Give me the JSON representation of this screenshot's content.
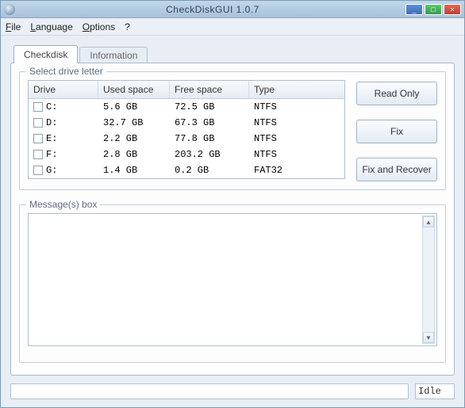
{
  "title": "CheckDiskGUI 1.0.7",
  "menu": {
    "file": "File",
    "language": "Language",
    "options": "Options",
    "help": "?"
  },
  "tabs": {
    "checkdisk": "Checkdisk",
    "information": "Information"
  },
  "drive_section": {
    "legend": "Select drive letter",
    "headers": {
      "drive": "Drive",
      "used": "Used space",
      "free": "Free space",
      "type": "Type"
    },
    "rows": [
      {
        "drive": "C:",
        "used": "5.6 GB",
        "free": "72.5 GB",
        "type": "NTFS"
      },
      {
        "drive": "D:",
        "used": "32.7 GB",
        "free": "67.3 GB",
        "type": "NTFS"
      },
      {
        "drive": "E:",
        "used": "2.2 GB",
        "free": "77.8 GB",
        "type": "NTFS"
      },
      {
        "drive": "F:",
        "used": "2.8 GB",
        "free": "203.2 GB",
        "type": "NTFS"
      },
      {
        "drive": "G:",
        "used": "1.4 GB",
        "free": "0.2 GB",
        "type": "FAT32"
      }
    ]
  },
  "actions": {
    "read_only": "Read Only",
    "fix": "Fix",
    "fix_recover": "Fix and Recover"
  },
  "messages": {
    "legend": "Message(s) box"
  },
  "status": {
    "label": "Idle"
  }
}
